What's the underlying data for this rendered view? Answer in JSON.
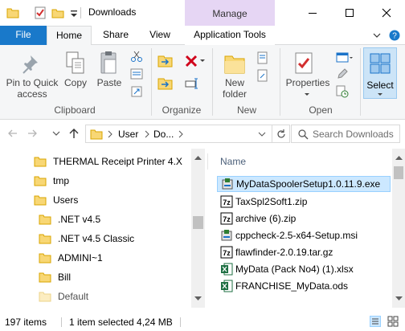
{
  "window": {
    "title": "Downloads",
    "manage_label": "Manage"
  },
  "ribbon_tabs": {
    "file": "File",
    "home": "Home",
    "share": "Share",
    "view": "View",
    "app_tools": "Application Tools"
  },
  "ribbon": {
    "pin_label_1": "Pin to Quick",
    "pin_label_2": "access",
    "copy": "Copy",
    "paste": "Paste",
    "new_folder_1": "New",
    "new_folder_2": "folder",
    "properties": "Properties",
    "select": "Select",
    "groups": {
      "clipboard": "Clipboard",
      "organize": "Organize",
      "new": "New",
      "open": "Open"
    }
  },
  "address": {
    "crumbs": [
      "User",
      "Do..."
    ],
    "search_placeholder": "Search Downloads"
  },
  "nav_items": [
    "THERMAL Receipt Printer 4.X",
    "tmp",
    "Users",
    ".NET v4.5",
    ".NET v4.5 Classic",
    "ADMINI~1",
    "Bill",
    "Default"
  ],
  "file_list": {
    "column_name": "Name",
    "files": [
      {
        "name": "MyDataSpoolerSetup1.0.11.9.exe",
        "icon": "installer-icon",
        "selected": true
      },
      {
        "name": "TaxSpl2Soft1.zip",
        "icon": "7zip-archive-icon",
        "selected": false
      },
      {
        "name": "archive (6).zip",
        "icon": "7zip-archive-icon",
        "selected": false
      },
      {
        "name": "cppcheck-2.5-x64-Setup.msi",
        "icon": "installer-icon",
        "selected": false
      },
      {
        "name": "flawfinder-2.0.19.tar.gz",
        "icon": "7zip-archive-icon",
        "selected": false
      },
      {
        "name": "MyData (Pack No4) (1).xlsx",
        "icon": "excel-icon",
        "selected": false
      },
      {
        "name": "FRANCHISE_MyData.ods",
        "icon": "excel-icon",
        "selected": false
      }
    ]
  },
  "status": {
    "count": "197 items",
    "selection": "1 item selected  4,24 MB"
  },
  "colors": {
    "file_tab": "#1979ca",
    "manage": "#e6d6f4",
    "selection": "#cce8ff",
    "folder": "#f8d775"
  }
}
